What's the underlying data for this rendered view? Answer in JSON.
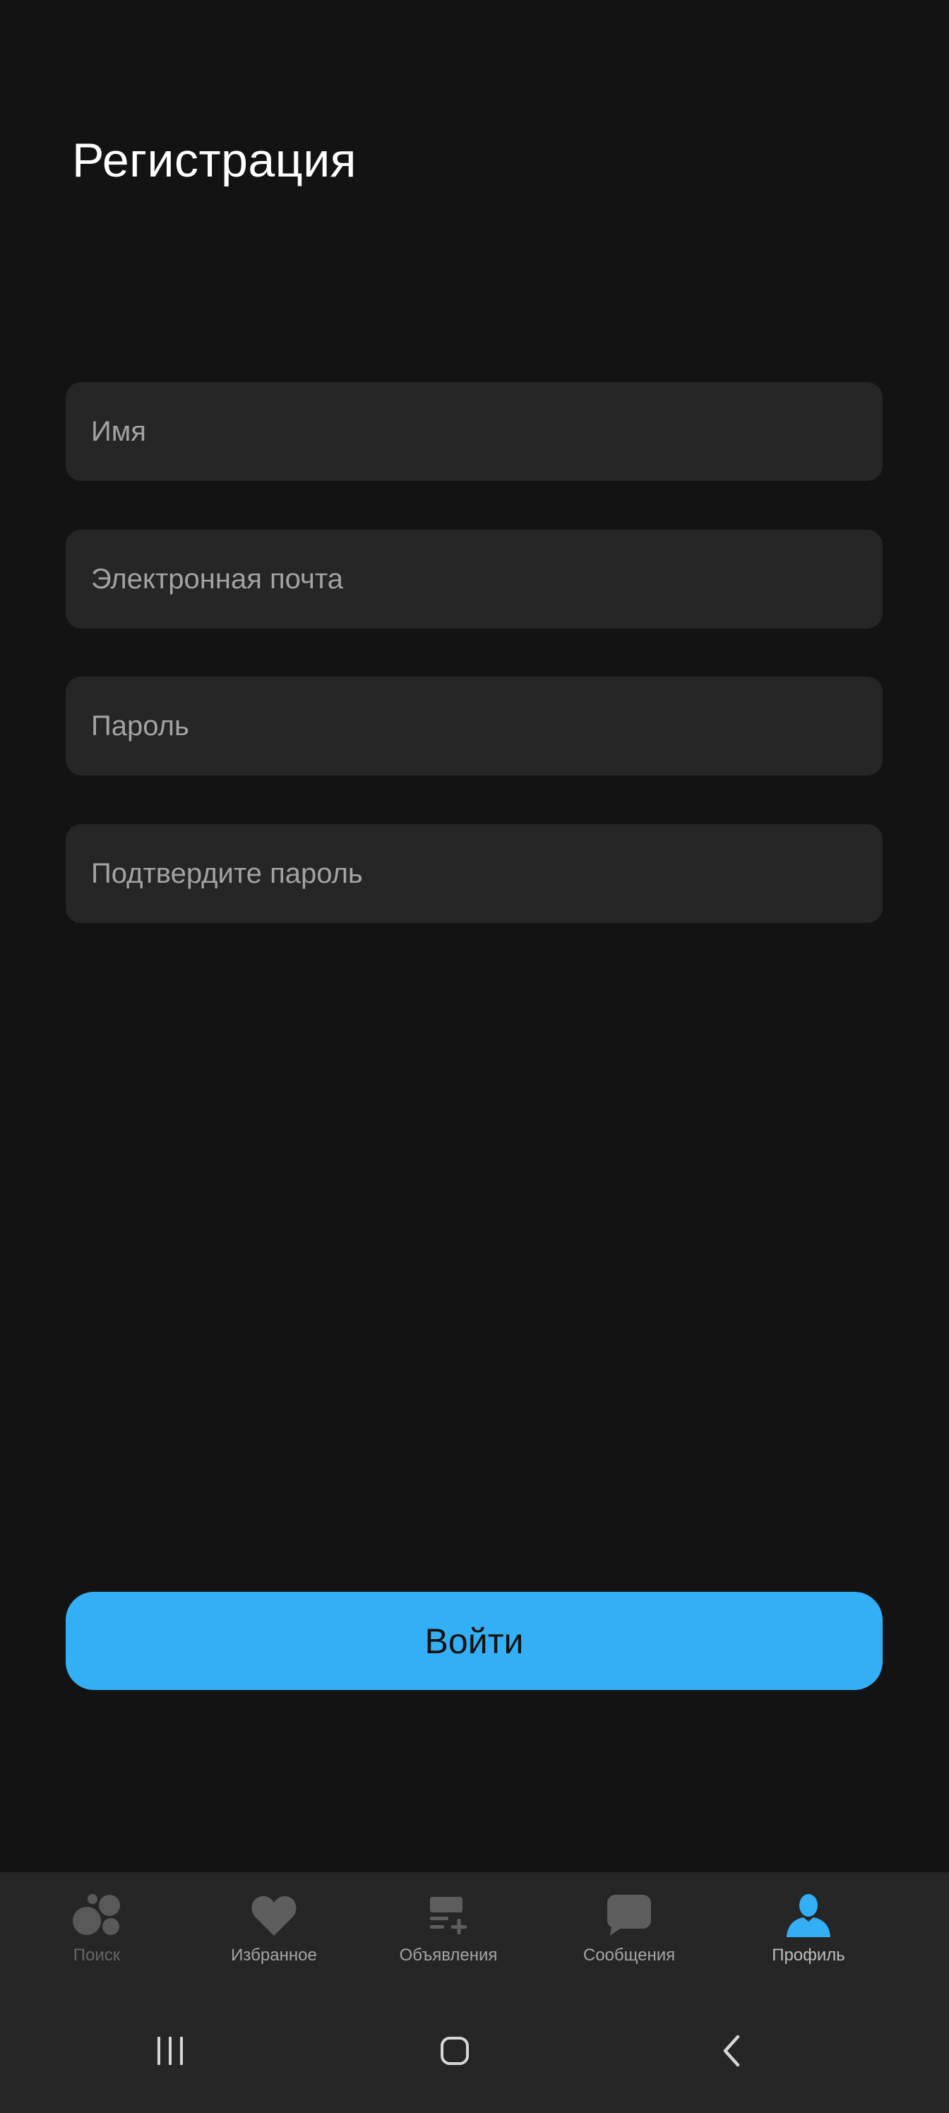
{
  "header": {
    "title": "Регистрация"
  },
  "form": {
    "name_placeholder": "Имя",
    "email_placeholder": "Электронная почта",
    "password_placeholder": "Пароль",
    "confirm_password_placeholder": "Подтвердите пароль"
  },
  "actions": {
    "submit_label": "Войти"
  },
  "bottom_nav": {
    "items": [
      {
        "label": "Поиск",
        "icon": "bubbles-icon",
        "state": "disabled"
      },
      {
        "label": "Избранное",
        "icon": "heart-icon",
        "state": "normal"
      },
      {
        "label": "Объявления",
        "icon": "list-add-icon",
        "state": "normal"
      },
      {
        "label": "Сообщения",
        "icon": "chat-icon",
        "state": "normal"
      },
      {
        "label": "Профиль",
        "icon": "person-icon",
        "state": "active"
      }
    ]
  },
  "system_nav": {
    "buttons": [
      "recent-apps-icon",
      "home-icon",
      "back-icon"
    ]
  },
  "colors": {
    "background": "#131314",
    "field_background": "#262626",
    "accent": "#33b0f5",
    "nav_background": "#262626"
  }
}
